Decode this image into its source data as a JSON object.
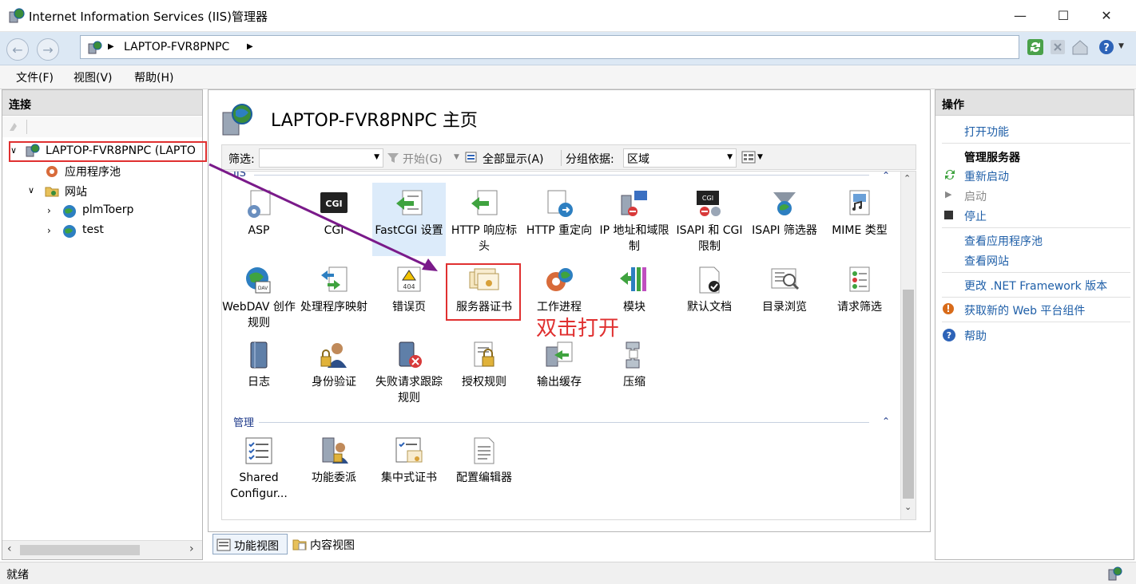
{
  "window": {
    "title": "Internet Information Services (IIS)管理器",
    "controls": {
      "minimize": "—",
      "maximize": "☐",
      "close": "✕"
    }
  },
  "address": {
    "segments": [
      "LAPTOP-FVR8PNPC"
    ]
  },
  "menu": [
    "文件(F)",
    "视图(V)",
    "帮助(H)"
  ],
  "connections": {
    "title": "连接",
    "tree": [
      {
        "label": "LAPTOP-FVR8PNPC (LAPTO",
        "level": 0,
        "expanded": true
      },
      {
        "label": "应用程序池",
        "level": 1
      },
      {
        "label": "网站",
        "level": 1,
        "expanded": true
      },
      {
        "label": "plmToerp",
        "level": 2
      },
      {
        "label": "test",
        "level": 2
      }
    ]
  },
  "main": {
    "title": "LAPTOP-FVR8PNPC 主页",
    "filter": {
      "label": "筛选:",
      "start": "开始(G)",
      "show_all": "全部显示(A)",
      "group_by_label": "分组依据:",
      "group_by_value": "区域"
    },
    "groups": [
      {
        "name": "IIS",
        "features": [
          "ASP",
          "CGI",
          "FastCGI 设置",
          "HTTP 响应标头",
          "HTTP 重定向",
          "IP 地址和域限制",
          "ISAPI 和 CGI 限制",
          "ISAPI 筛选器",
          "MIME 类型",
          "WebDAV 创作规则",
          "处理程序映射",
          "错误页",
          "服务器证书",
          "工作进程",
          "模块",
          "默认文档",
          "目录浏览",
          "请求筛选",
          "日志",
          "身份验证",
          "失败请求跟踪规则",
          "授权规则",
          "输出缓存",
          "压缩"
        ]
      },
      {
        "name": "管理",
        "features": [
          "Shared Configur...",
          "功能委派",
          "集中式证书",
          "配置编辑器"
        ]
      }
    ],
    "annotation": "双击打开",
    "tabs": [
      "功能视图",
      "内容视图"
    ]
  },
  "actions": {
    "title": "操作",
    "open_feature": "打开功能",
    "manage_server": "管理服务器",
    "restart": "重新启动",
    "start": "启动",
    "stop": "停止",
    "view_app_pools": "查看应用程序池",
    "view_sites": "查看网站",
    "change_net": "更改 .NET Framework 版本",
    "get_web_platform": "获取新的 Web 平台组件",
    "help": "帮助"
  },
  "status": "就绪",
  "colors": {
    "accent": "#1f5fa8",
    "highlight": "#e03030",
    "arrow": "#7a1a8a"
  }
}
